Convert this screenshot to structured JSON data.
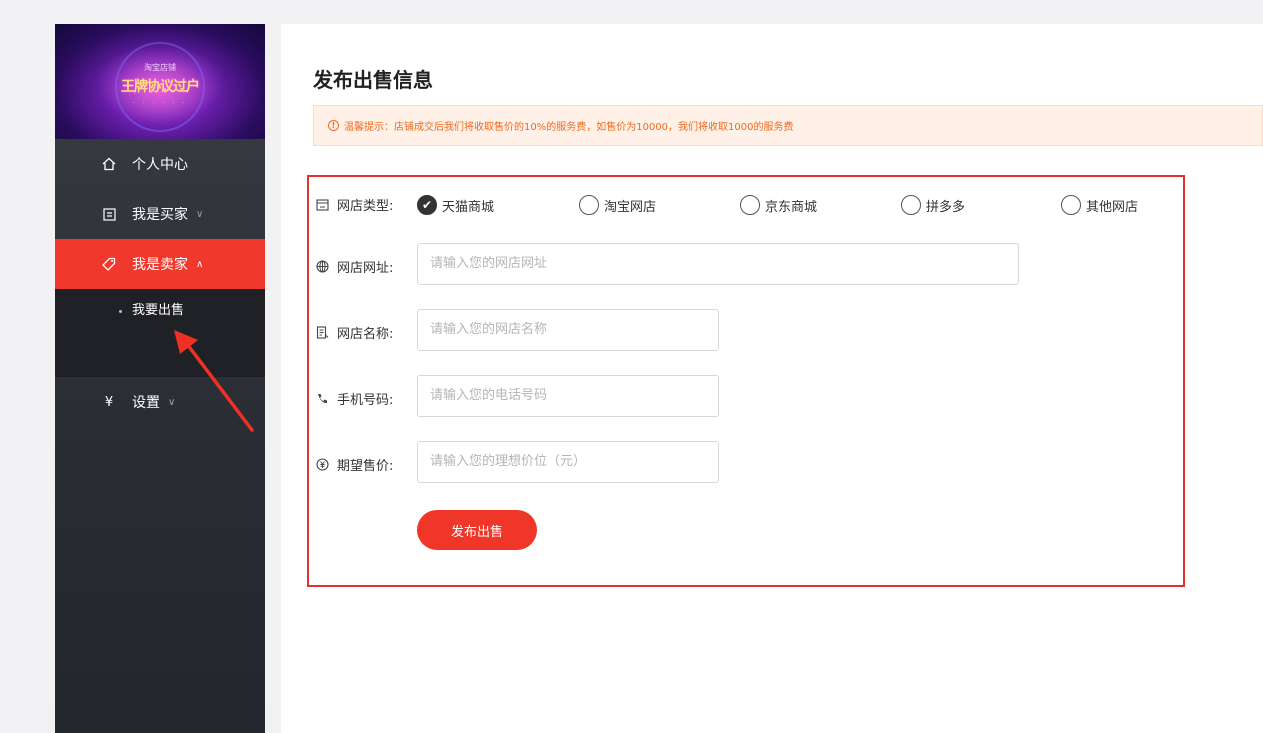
{
  "sidebar": {
    "banner": {
      "sub_top": "淘宝店铺",
      "title": "王牌协议过户",
      "sub_bottom": "· · · · · ·"
    },
    "items": [
      {
        "label": "个人中心",
        "icon": "home-icon"
      },
      {
        "label": "我是买家",
        "icon": "list-icon",
        "chevron": "∨"
      },
      {
        "label": "我是卖家",
        "icon": "tag-icon",
        "chevron": "∧"
      },
      {
        "label": "设置",
        "icon": "yen-icon",
        "chevron": "∨"
      }
    ],
    "submenu": [
      {
        "label": "我要出售"
      }
    ],
    "colors": {
      "active": "#f0382c",
      "bg": "#2a2d34"
    }
  },
  "main": {
    "title": "发布出售信息",
    "notice": "温馨提示：店铺成交后我们将收取售价的10%的服务费，如售价为10000，我们将收取1000的服务费",
    "form": {
      "shop_type": {
        "label": "网店类型:",
        "options": [
          {
            "label": "天猫商城",
            "checked": true
          },
          {
            "label": "淘宝网店",
            "checked": false
          },
          {
            "label": "京东商城",
            "checked": false
          },
          {
            "label": "拼多多",
            "checked": false
          },
          {
            "label": "其他网店",
            "checked": false
          }
        ]
      },
      "shop_url": {
        "label": "网店网址:",
        "placeholder": "请输入您的网店网址"
      },
      "shop_name": {
        "label": "网店名称:",
        "placeholder": "请输入您的网店名称"
      },
      "phone": {
        "label": "手机号码:",
        "placeholder": "请输入您的电话号码"
      },
      "price": {
        "label": "期望售价:",
        "placeholder": "请输入您的理想价位（元）"
      },
      "submit_label": "发布出售"
    },
    "colors": {
      "accent": "#ef3628",
      "notice_text": "#f06a1f"
    }
  }
}
